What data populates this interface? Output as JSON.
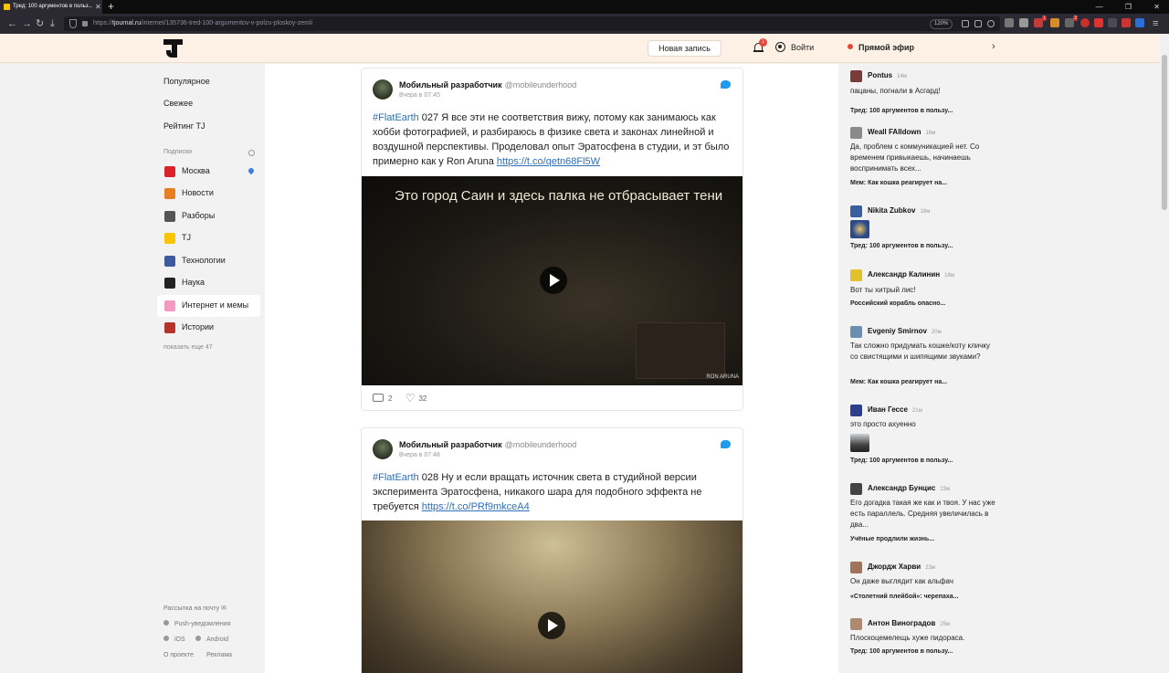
{
  "browser": {
    "tab_title": "Тред: 100 аргументов в польз...",
    "url_domain": "tjournal.ru",
    "url_path": "/internet/135736-tred-100-argumentov-v-polzu-ploskoy-zemli",
    "url_prefix": "https://",
    "zoom": "120%",
    "ext_badge_1": "1",
    "ext_badge_2": "2"
  },
  "header": {
    "new_post": "Новая запись",
    "notif_count": "1",
    "login": "Войти",
    "live": "Прямой эфир"
  },
  "sidebar": {
    "main": [
      "Популярное",
      "Свежее",
      "Рейтинг TJ"
    ],
    "subs_title": "Подписки",
    "subs": [
      {
        "label": "Москва",
        "color": "#d8232a"
      },
      {
        "label": "Новости",
        "color": "#e67e22"
      },
      {
        "label": "Разборы",
        "color": "#555555"
      },
      {
        "label": "TJ",
        "color": "#f7c600"
      },
      {
        "label": "Технологии",
        "color": "#3d5a9e"
      },
      {
        "label": "Наука",
        "color": "#222222"
      },
      {
        "label": "Интернет и мемы",
        "color": "#f39ac0"
      },
      {
        "label": "Истории",
        "color": "#b5332c"
      }
    ],
    "show_more": "показать еще 47",
    "footer": {
      "newsletter": "Рассылка на почту",
      "push": "Push-уведомления",
      "ios": "iOS",
      "android": "Android",
      "about": "О проекте",
      "ads": "Реклама"
    }
  },
  "tweets": [
    {
      "author": "Мобильный разработчик",
      "handle": "@mobileunderhood",
      "time": "Вчера в 07:45",
      "tag": "#FlatEarth",
      "text": " 027 Я все эти не соответствия вижу, потому как занимаюсь как хобби фотографией, и разбираюсь в физике света и законах линейной и воздушной перспективы. Проделовал опыт Эратосфена в студии, и эт было примерно как у Ron Aruna ",
      "link": "https://t.co/qetn68Fl5W",
      "caption": "Это город Саин и здесь палка не отбрасывает тени",
      "watermark": "RON ARUNA",
      "retweets": "2",
      "likes": "32"
    },
    {
      "author": "Мобильный разработчик",
      "handle": "@mobileunderhood",
      "time": "Вчера в 07:48",
      "tag": "#FlatEarth",
      "text": " 028 Ну и если вращать источник света в студийной версии эксперимента Эратосфена, никакого шара для подобного эффекта не требуется ",
      "link": "https://t.co/PRf9mkceA4"
    }
  ],
  "comments": [
    {
      "user": "Pontus",
      "time": "14м",
      "text": "пацаны, погнали в Асгард!",
      "post": "Тред: 100 аргументов в пользу...",
      "color": "#7a3b3b"
    },
    {
      "user": "Weall FAlldown",
      "time": "16м",
      "text": "Да, проблем с коммуникацией нет. Со временем привыкаешь, начинаешь воспринимать всех...",
      "post": "Мем: Как кошка реагирует на...",
      "color": "#8a8a8a"
    },
    {
      "user": "Nikita Zubkov",
      "time": "18м",
      "text": "",
      "post": "Тред: 100 аргументов в пользу...",
      "color": "#3a5f9e"
    },
    {
      "user": "Александр Калинин",
      "time": "18м",
      "text": "Вот ты хитрый лис!",
      "post": "Российский корабль опасно...",
      "color": "#e2c12b"
    },
    {
      "user": "Evgeniy Smirnov",
      "time": "20м",
      "text": "Так сложно придумать кошке/коту кличку со свистящими и шипящими звуками?",
      "post": "Мем: Как кошка реагирует на...",
      "color": "#6a8fb0"
    },
    {
      "user": "Иван Гессе",
      "time": "21м",
      "text": "это просто ахуенно",
      "post": "Тред: 100 аргументов в пользу...",
      "color": "#2d3f8c"
    },
    {
      "user": "Александр Бунцис",
      "time": "23м",
      "text": "Его догадка такая же как и твоя. У нас уже есть параллель. Средняя увеличилась в два...",
      "post": "Учёные продлили жизнь...",
      "color": "#444444"
    },
    {
      "user": "Джордж Харви",
      "time": "23м",
      "text": "Он даже выглядит как альфач",
      "post": "«Столетний плейбой»: черепаха...",
      "color": "#a0735a"
    },
    {
      "user": "Антон Виноградов",
      "time": "25м",
      "text": "Плоскоцемелещь хуже пидораса.",
      "post": "Тред: 100 аргументов в пользу...",
      "color": "#b08a70"
    }
  ]
}
